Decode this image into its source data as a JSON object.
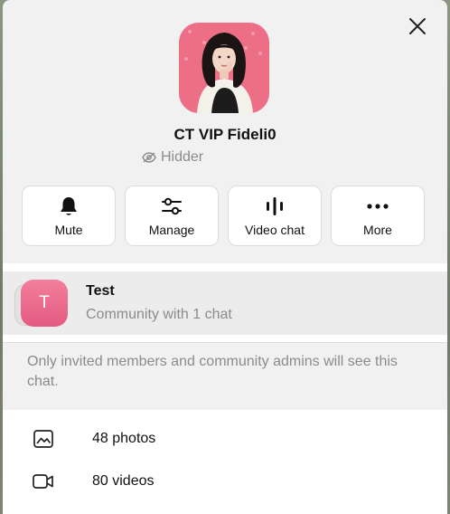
{
  "profile": {
    "name": "CT VIP Fideli0",
    "status": "Hidder"
  },
  "actions": [
    {
      "label": "Mute",
      "icon": "bell-icon"
    },
    {
      "label": "Manage",
      "icon": "sliders-icon"
    },
    {
      "label": "Video chat",
      "icon": "video-chat-icon"
    },
    {
      "label": "More",
      "icon": "more-icon"
    }
  ],
  "community": {
    "avatar_letter": "T",
    "title": "Test",
    "subtitle": "Community with 1 chat"
  },
  "note": "Only invited members and community admins will see this chat.",
  "media": [
    {
      "label": "48 photos",
      "icon": "photo-icon"
    },
    {
      "label": "80 videos",
      "icon": "video-icon"
    }
  ],
  "colors": {
    "accent_pink": "#e45a80",
    "muted_text": "#8b8b8b",
    "panel_bg": "#f1f1f1"
  }
}
